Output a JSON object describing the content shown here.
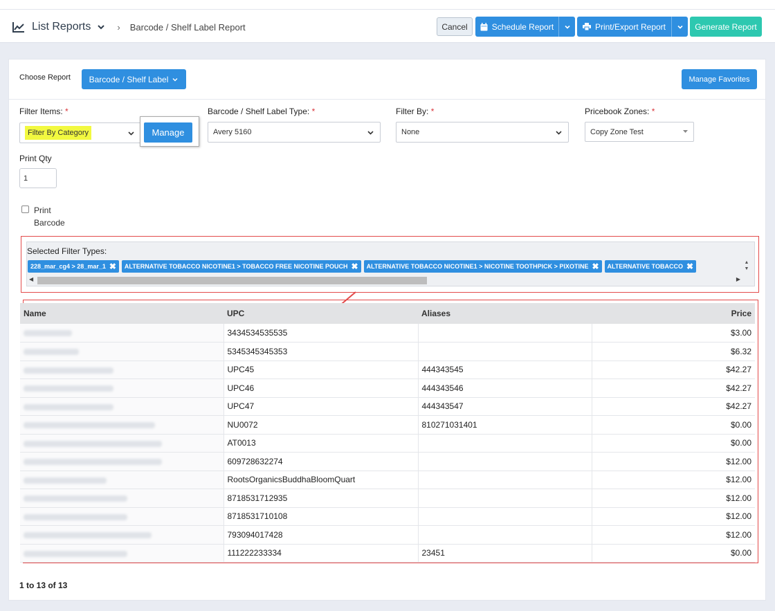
{
  "header": {
    "title": "List Reports",
    "breadcrumb_current": "Barcode / Shelf Label Report",
    "buttons": {
      "cancel": "Cancel",
      "schedule": "Schedule Report",
      "print_export": "Print/Export Report",
      "generate": "Generate Report"
    }
  },
  "report_chooser": {
    "label": "Choose Report",
    "selected": "Barcode / Shelf Label",
    "favorites": "Manage Favorites"
  },
  "filters": {
    "filter_items": {
      "label": "Filter Items:",
      "value": "Filter By Category",
      "manage": "Manage"
    },
    "label_type": {
      "label": "Barcode / Shelf Label Type:",
      "value": "Avery 5160"
    },
    "filter_by": {
      "label": "Filter By:",
      "value": "None"
    },
    "pricebook_zones": {
      "label": "Pricebook Zones:",
      "value": "Copy Zone Test"
    },
    "print_qty": {
      "label": "Print Qty",
      "value": "1"
    },
    "print_barcode": {
      "label": "Print Barcode",
      "checked": false
    },
    "required_mark": "*"
  },
  "selected_filters": {
    "title": "Selected Filter Types:",
    "chips": [
      "228_mar_cg4 > 28_mar_1",
      "ALTERNATIVE TOBACCO NICOTINE1 > TOBACCO FREE NICOTINE POUCH",
      "ALTERNATIVE TOBACCO NICOTINE1 > NICOTINE TOOTHPICK > PIXOTINE",
      "ALTERNATIVE TOBACCO"
    ]
  },
  "table": {
    "columns": [
      "Name",
      "UPC",
      "Aliases",
      "Price"
    ],
    "rows": [
      {
        "upc": "3434534535535",
        "alias": "",
        "price": "$3.00"
      },
      {
        "upc": "5345345345353",
        "alias": "",
        "price": "$6.32"
      },
      {
        "upc": "UPC45",
        "alias": "444343545",
        "price": "$42.27"
      },
      {
        "upc": "UPC46",
        "alias": "444343546",
        "price": "$42.27"
      },
      {
        "upc": "UPC47",
        "alias": "444343547",
        "price": "$42.27"
      },
      {
        "upc": "NU0072",
        "alias": "810271031401",
        "price": "$0.00"
      },
      {
        "upc": "AT0013",
        "alias": "",
        "price": "$0.00"
      },
      {
        "upc": "609728632274",
        "alias": "",
        "price": "$12.00"
      },
      {
        "upc": "RootsOrganicsBuddhaBloomQuart",
        "alias": "",
        "price": "$12.00"
      },
      {
        "upc": "8718531712935",
        "alias": "",
        "price": "$12.00"
      },
      {
        "upc": "8718531710108",
        "alias": "",
        "price": "$12.00"
      },
      {
        "upc": "793094017428",
        "alias": "",
        "price": "$12.00"
      },
      {
        "upc": "111222233334",
        "alias": "23451",
        "price": "$0.00"
      }
    ]
  },
  "pager": {
    "text": "1 to 13 of 13"
  },
  "colors": {
    "primary": "#2f8fe0",
    "generate": "#2dc8b0",
    "highlight": "#f2f940",
    "annotation": "#e34a4a"
  }
}
